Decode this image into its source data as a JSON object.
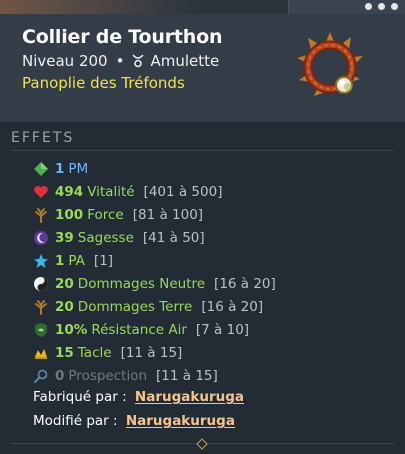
{
  "item": {
    "name": "Collier de Tourthon",
    "level_text": "Niveau 200",
    "separator": "•",
    "type": "Amulette",
    "set_name": "Panoplie des Tréfonds"
  },
  "effects_title": "EFFETS",
  "effects": [
    {
      "value": "1",
      "label": "PM",
      "range": "",
      "icon": "pm-diamond-icon"
    },
    {
      "value": "494",
      "label": "Vitalité",
      "range": "[401 à 500]",
      "icon": "heart-icon"
    },
    {
      "value": "100",
      "label": "Force",
      "range": "[81 à 100]",
      "icon": "force-icon"
    },
    {
      "value": "39",
      "label": "Sagesse",
      "range": "[41 à 50]",
      "icon": "wisdom-moon-icon"
    },
    {
      "value": "1",
      "label": "PA",
      "range": "[1]",
      "icon": "pa-star-icon"
    },
    {
      "value": "20",
      "label": "Dommages Neutre",
      "range": "[16 à 20]",
      "icon": "neutral-yin-yang-icon"
    },
    {
      "value": "20",
      "label": "Dommages Terre",
      "range": "[16 à 20]",
      "icon": "earth-icon"
    },
    {
      "value": "10%",
      "label": "Résistance Air",
      "range": "[7 à 10]",
      "icon": "air-shield-icon"
    },
    {
      "value": "15",
      "label": "Tacle",
      "range": "[11 à 15]",
      "icon": "tackle-icon"
    },
    {
      "value": "0",
      "label": "Prospection",
      "range": "[11 à 15]",
      "icon": "prospecting-magnifier-icon"
    }
  ],
  "crafted": {
    "label": "Fabriqué par :",
    "name": "Narugakuruga"
  },
  "modified": {
    "label": "Modifié par :",
    "name": "Narugakuruga"
  },
  "colors": {
    "stat_green": "#9ad85a",
    "stat_blue": "#6cb5ff",
    "set_yellow": "#efe54a",
    "creator_gold": "#f5c58f"
  }
}
